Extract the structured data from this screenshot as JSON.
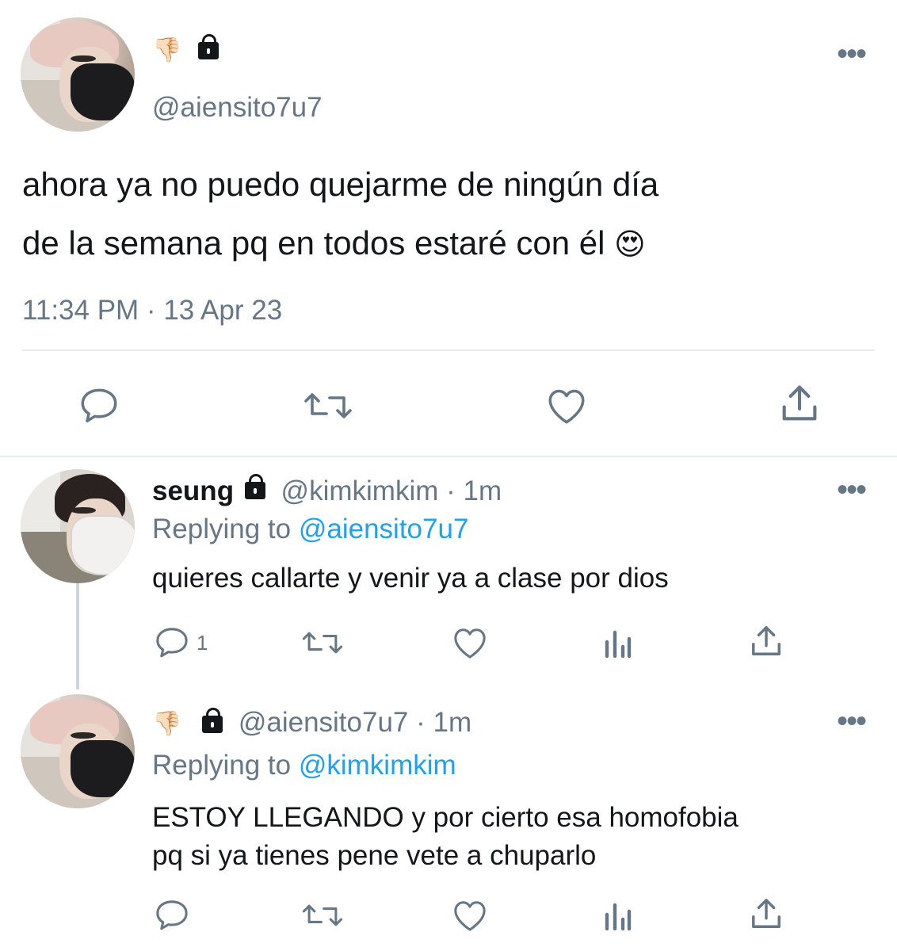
{
  "main_tweet": {
    "handle": "@aiensito7u7",
    "text_line1": "ahora ya no puedo quejarme de ningún día",
    "text_line2": "de la semana pq en todos estaré con él",
    "emoji": "😍",
    "thumb_emoji": "👎🏻",
    "timestamp": "11:34 PM · 13 Apr 23"
  },
  "reply1": {
    "name": "seung",
    "handle": "@kimkimkim",
    "time": "· 1m",
    "replying_prefix": "Replying to",
    "replying_handle": "@aiensito7u7",
    "text": "quieres callarte y venir ya a clase por dios",
    "reply_count": "1"
  },
  "reply2": {
    "thumb_emoji": "👎🏻",
    "handle": "@aiensito7u7",
    "time": "· 1m",
    "replying_prefix": "Replying to",
    "replying_handle": "@kimkimkim",
    "text_line1": "ESTOY LLEGANDO y por cierto esa homofobia",
    "text_line2": "pq si ya tienes pene vete a chuparlo"
  },
  "more_glyph": "•••",
  "colors": {
    "muted": "#657786",
    "link": "#1da1f2",
    "text": "#14171a",
    "divider": "#e6ecf0"
  },
  "icons": [
    "reply-icon",
    "retweet-icon",
    "like-icon",
    "share-icon",
    "analytics-icon",
    "more-icon",
    "lock-icon"
  ]
}
